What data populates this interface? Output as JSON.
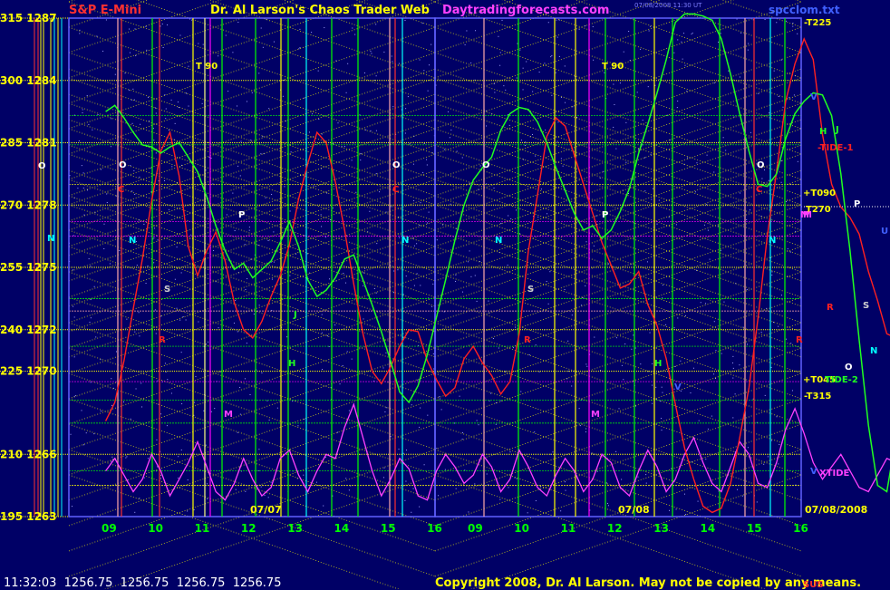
{
  "header": {
    "instrument": "S&P E-Mini",
    "title": "Dr. Al Larson's Chaos Trader Web",
    "site": "Daytradingforecasts.com",
    "timestamp": "07/08/2008 11:30 UT",
    "file": "spcclom.txt"
  },
  "footer": {
    "quote": "11:32:03  1256.75  1256.75  1256.75  1256.75",
    "copyright": "Copyright 2008, Dr. Al Larson.  May not be copied by any means.",
    "corner_mark": "SUS"
  },
  "colors": {
    "background": "#000066",
    "price_right": "#ff2020",
    "price_left": "#20ff20",
    "tide": "#ff40ff",
    "yellow": "#ffff00",
    "green": "#00ff00",
    "cyan": "#00ffff",
    "magenta": "#ff00ff",
    "white": "#ffffff",
    "pink": "#ffaaaa",
    "red_vertical": "#ff3030"
  },
  "chart_data": {
    "type": "line",
    "y_ticks": [
      {
        "label": "315  1287",
        "value": 1287
      },
      {
        "label": "300  1284",
        "value": 1284
      },
      {
        "label": "285  1281",
        "value": 1281
      },
      {
        "label": "270  1278",
        "value": 1278
      },
      {
        "label": "255  1275",
        "value": 1275
      },
      {
        "label": "240  1272",
        "value": 1272
      },
      {
        "label": "225  1270",
        "value": 1270
      },
      {
        "label": "210  1266",
        "value": 1266
      },
      {
        "label": "195  1263",
        "value": 1263
      }
    ],
    "ylim": [
      1263,
      1287
    ],
    "x_hours_left": [
      "09",
      "10",
      "11",
      "12",
      "13",
      "14",
      "15",
      "16"
    ],
    "x_hours_right": [
      "09",
      "10",
      "11",
      "12",
      "13",
      "14",
      "15",
      "16"
    ],
    "dates": [
      "07/07",
      "07/08",
      "07/08/2008"
    ],
    "right_labels": [
      {
        "text": "-T225",
        "color": "#ffff00"
      },
      {
        "text": "V",
        "color": "#4060ff"
      },
      {
        "text": "H",
        "color": "#20ff20"
      },
      {
        "text": "J",
        "color": "#20ff20"
      },
      {
        "text": "-TIDE-1",
        "color": "#ff2020"
      },
      {
        "text": "+T090",
        "color": "#ffff00"
      },
      {
        "text": "P",
        "color": "#ffffff"
      },
      {
        "text": "T270",
        "color": "#ffff00"
      },
      {
        "text": "M",
        "color": "#ff40ff"
      },
      {
        "text": "U",
        "color": "#4060ff"
      },
      {
        "text": "R",
        "color": "#ff2020"
      },
      {
        "text": "S",
        "color": "#d0d0d0"
      },
      {
        "text": "N",
        "color": "#00ffff"
      },
      {
        "text": "O",
        "color": "#ffffff"
      },
      {
        "text": "+T045",
        "color": "#ffff00"
      },
      {
        "text": "TIDE-2",
        "color": "#20ff20"
      },
      {
        "text": "-T315",
        "color": "#ffff00"
      },
      {
        "text": "V",
        "color": "#4060ff"
      },
      {
        "text": "XTIDE",
        "color": "#ff40ff"
      }
    ],
    "inplot_labels": [
      {
        "text": "T 90",
        "color": "#ffff00"
      },
      {
        "text": "T 90",
        "color": "#ffff00"
      },
      {
        "text": "O",
        "color": "#ffffff"
      },
      {
        "text": "O",
        "color": "#ffffff"
      },
      {
        "text": "O",
        "color": "#ffffff"
      },
      {
        "text": "O",
        "color": "#ffffff"
      },
      {
        "text": "N",
        "color": "#00ffff"
      },
      {
        "text": "N",
        "color": "#00ffff"
      },
      {
        "text": "N",
        "color": "#00ffff"
      },
      {
        "text": "N",
        "color": "#00ffff"
      },
      {
        "text": "P",
        "color": "#ffffff"
      },
      {
        "text": "P",
        "color": "#ffffff"
      },
      {
        "text": "S",
        "color": "#d0d0d0"
      },
      {
        "text": "S",
        "color": "#d0d0d0"
      },
      {
        "text": "R",
        "color": "#ff2020"
      },
      {
        "text": "R",
        "color": "#ff2020"
      },
      {
        "text": "R",
        "color": "#ff2020"
      },
      {
        "text": "M",
        "color": "#ff40ff"
      },
      {
        "text": "M",
        "color": "#ff40ff"
      },
      {
        "text": "M",
        "color": "#ff40ff"
      },
      {
        "text": "C",
        "color": "#ff2020"
      },
      {
        "text": "C",
        "color": "#ff2020"
      },
      {
        "text": "C",
        "color": "#ff2020"
      },
      {
        "text": "H",
        "color": "#20ff20"
      },
      {
        "text": "H",
        "color": "#20ff20"
      },
      {
        "text": "J",
        "color": "#20ff20"
      },
      {
        "text": "V",
        "color": "#4060ff"
      }
    ]
  }
}
